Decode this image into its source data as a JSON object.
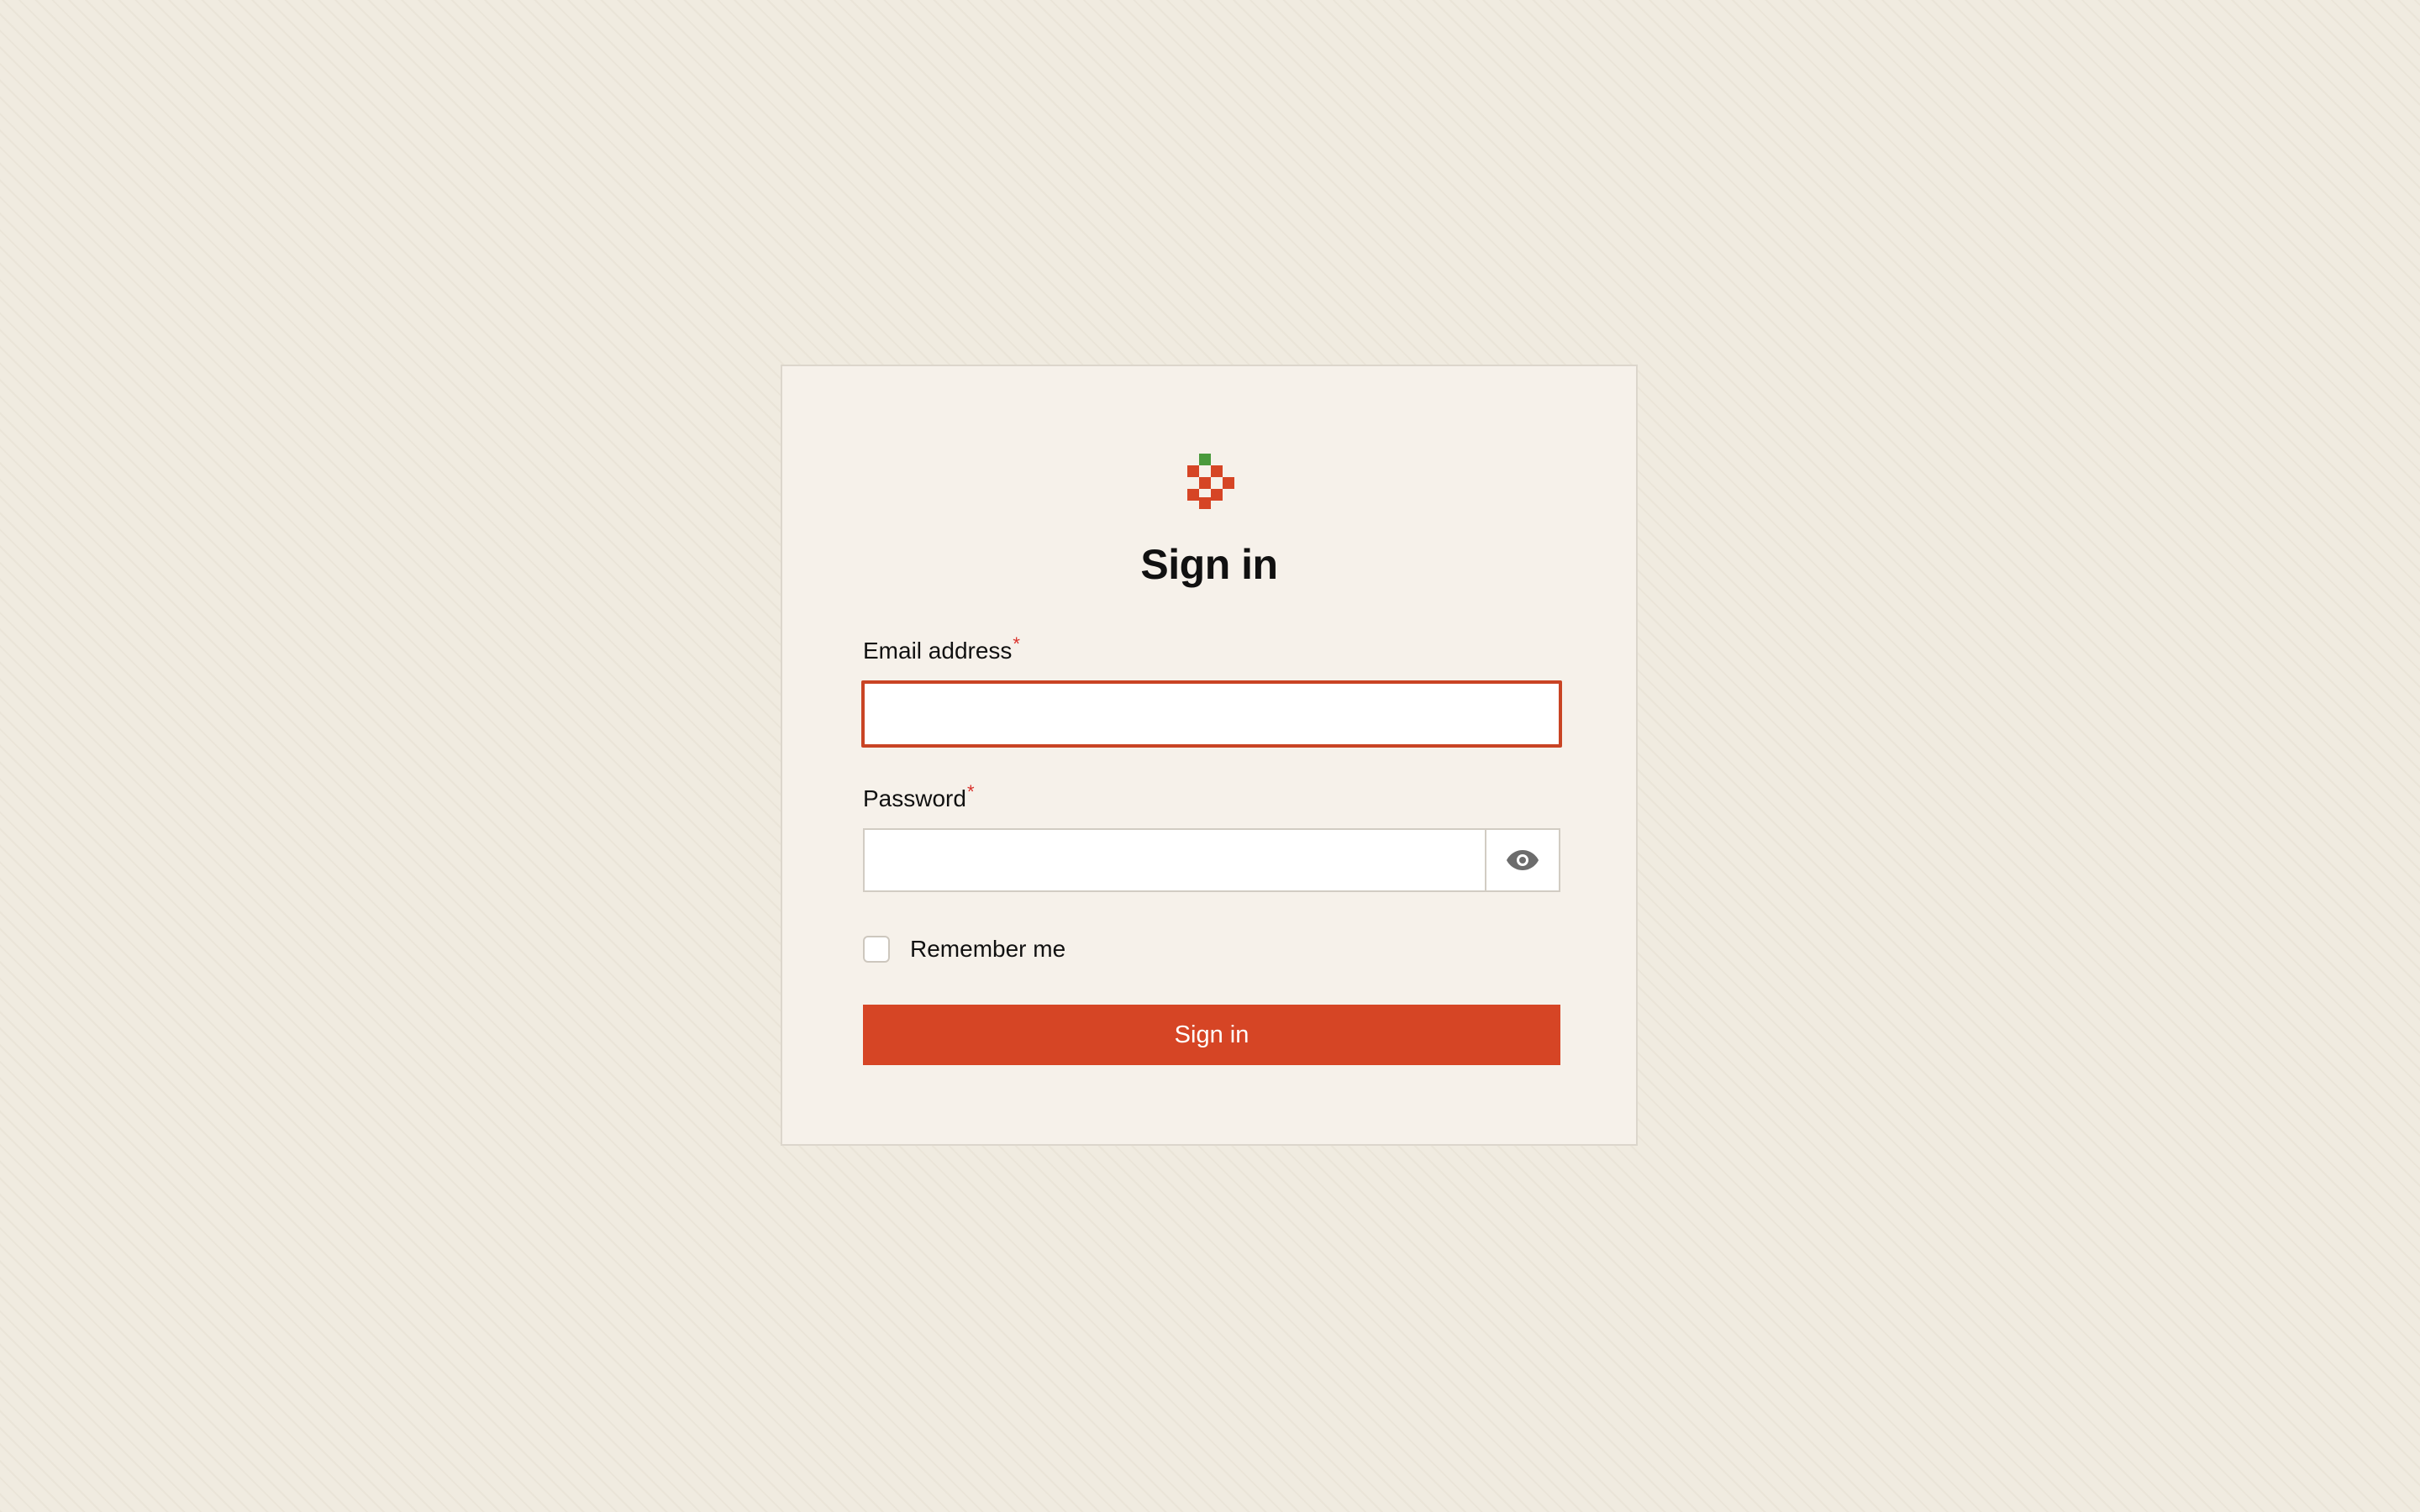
{
  "app": {
    "title": "Sign in",
    "logo_icon": "pixel-strawberry-icon"
  },
  "form": {
    "email": {
      "label": "Email address",
      "required_marker": "*",
      "value": "",
      "placeholder": ""
    },
    "password": {
      "label": "Password",
      "required_marker": "*",
      "value": "",
      "placeholder": "",
      "toggle_icon": "eye-icon"
    },
    "remember": {
      "label": "Remember me",
      "checked": false
    },
    "submit_label": "Sign in"
  },
  "colors": {
    "accent": "#d64525",
    "focus_border": "#c94424",
    "required": "#d9302a",
    "leaf": "#4a9a3c",
    "background": "#f0ebe0",
    "card": "#f6f1ea"
  }
}
